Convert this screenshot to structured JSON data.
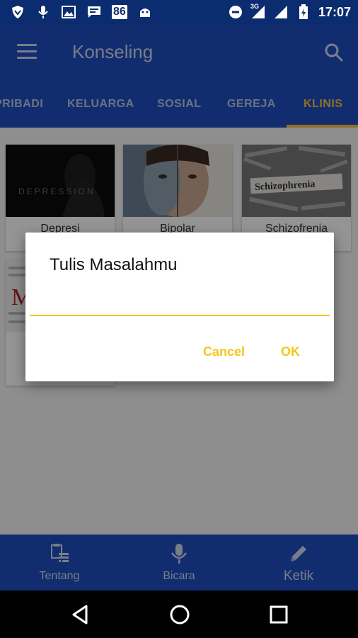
{
  "status_bar": {
    "notification_count": "86",
    "network_type": "3G",
    "time": "17:07",
    "icons": [
      "shield-icon",
      "mic-icon",
      "image-icon",
      "chat-icon",
      "android-icon",
      "dnd-icon",
      "signal-icon",
      "signal-icon",
      "battery-icon"
    ]
  },
  "app_bar": {
    "title": "Konseling"
  },
  "tabs": [
    {
      "label": "PRIBADI"
    },
    {
      "label": "KELUARGA"
    },
    {
      "label": "SOSIAL"
    },
    {
      "label": "GEREJA"
    },
    {
      "label": "KLINIS"
    }
  ],
  "active_tab": "KLINIS",
  "cards": [
    {
      "label": "Depresi",
      "image_text": "DEPRESSION"
    },
    {
      "label": "Bipolar",
      "image_text": ""
    },
    {
      "label": "Schizofrenia",
      "image_text": "Schizophrenia"
    },
    {
      "label": "",
      "image_text": "M"
    }
  ],
  "dialog": {
    "title": "Tulis Masalahmu",
    "input_value": "",
    "cancel_label": "Cancel",
    "ok_label": "OK"
  },
  "bottom_nav": [
    {
      "label": "Tentang",
      "icon": "tasks-icon"
    },
    {
      "label": "Bicara",
      "icon": "mic-icon"
    },
    {
      "label": "Ketik",
      "icon": "pencil-icon"
    }
  ],
  "colors": {
    "primary": "#1f4fbf",
    "accent": "#f5c242",
    "status_bar": "#0b2c6f",
    "dialog_accent": "#f5c518"
  }
}
